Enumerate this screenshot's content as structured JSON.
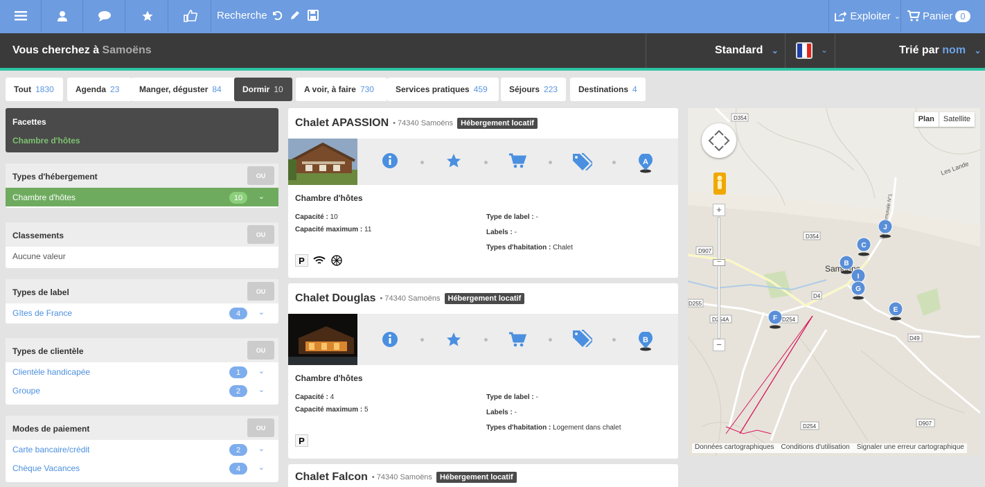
{
  "topbar": {
    "search_label": "Recherche",
    "exploiter_label": "Exploiter",
    "panier_label": "Panier",
    "panier_count": "0"
  },
  "searchbar": {
    "prefix": "Vous cherchez à",
    "city": "Samoëns",
    "view_mode": "Standard",
    "sort_prefix": "Trié par",
    "sort_field": "nom"
  },
  "tabs": [
    {
      "label": "Tout",
      "count": "1830"
    },
    {
      "label": "Agenda",
      "count": "23"
    },
    {
      "label": "Manger, déguster",
      "count": "84"
    },
    {
      "label": "Dormir",
      "count": "10"
    },
    {
      "label": "A voir, à faire",
      "count": "730"
    },
    {
      "label": "Services pratiques",
      "count": "459"
    },
    {
      "label": "Séjours",
      "count": "223"
    },
    {
      "label": "Destinations",
      "count": "4"
    }
  ],
  "facets": {
    "title": "Facettes",
    "active": "Chambre d'hôtes"
  },
  "filters": {
    "ou_label": "OU",
    "hebergement": {
      "title": "Types d'hébergement",
      "items": [
        {
          "label": "Chambre d'hôtes",
          "count": "10"
        }
      ]
    },
    "classements": {
      "title": "Classements",
      "empty": "Aucune valeur"
    },
    "label": {
      "title": "Types de label",
      "items": [
        {
          "label": "Gîtes de France",
          "count": "4"
        }
      ]
    },
    "clientele": {
      "title": "Types de clientèle",
      "items": [
        {
          "label": "Clientèle handicapée",
          "count": "1"
        },
        {
          "label": "Groupe",
          "count": "2"
        }
      ]
    },
    "paiement": {
      "title": "Modes de paiement",
      "items": [
        {
          "label": "Carte bancaire/crédit",
          "count": "2"
        },
        {
          "label": "Chèque Vacances",
          "count": "4"
        }
      ]
    }
  },
  "results": [
    {
      "name": "Chalet APASSION",
      "loc": "• 74340 Samoëns",
      "type": "Hébergement locatif",
      "marker": "A",
      "category": "Chambre d'hôtes",
      "capacite_k": "Capacité :",
      "capacite": "10",
      "capmax_k": "Capacité maximum :",
      "capmax": "11",
      "label_type_k": "Type de label :",
      "label_type": "-",
      "labels_k": "Labels :",
      "labels": "-",
      "habit_k": "Types d'habitation :",
      "habit": "Chalet"
    },
    {
      "name": "Chalet Douglas",
      "loc": "• 74340 Samoëns",
      "type": "Hébergement locatif",
      "marker": "B",
      "category": "Chambre d'hôtes",
      "capacite_k": "Capacité :",
      "capacite": "4",
      "capmax_k": "Capacité maximum :",
      "capmax": "5",
      "label_type_k": "Type de label :",
      "label_type": "-",
      "labels_k": "Labels :",
      "labels": "-",
      "habit_k": "Types d'habitation :",
      "habit": "Logement dans chalet"
    },
    {
      "name": "Chalet Falcon",
      "loc": "• 74340 Samoëns",
      "type": "Hébergement locatif"
    }
  ],
  "map": {
    "plan_label": "Plan",
    "satellite_label": "Satellite",
    "town": "Samoëns",
    "roads": [
      "D354",
      "D354",
      "D907",
      "D4",
      "D254",
      "D254A",
      "D255",
      "D49",
      "D254",
      "D907"
    ],
    "place": "Les Lande",
    "road_vertical": "Voie Communale N°1",
    "footer": [
      "Données cartographiques",
      "Conditions d'utilisation",
      "Signaler une erreur cartographique"
    ],
    "markers": [
      "A",
      "B",
      "C",
      "E",
      "F",
      "G",
      "I",
      "J"
    ]
  },
  "colors": {
    "topbar": "#6d9ce0",
    "accent": "#2ec4a4",
    "link": "#4b8fe0",
    "selected": "#6eab5f"
  }
}
